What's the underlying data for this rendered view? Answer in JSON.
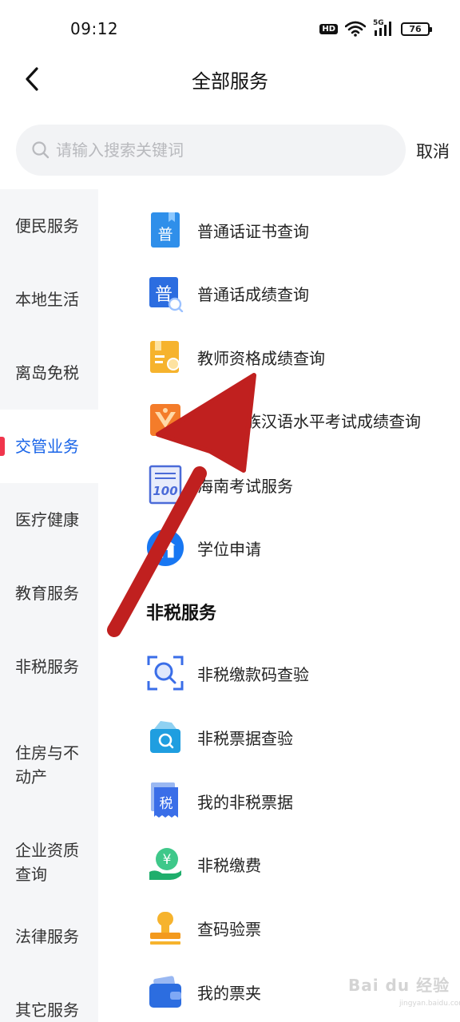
{
  "status_bar": {
    "time": "09:12",
    "hd": "HD",
    "signal_label": "5G",
    "battery": "76"
  },
  "header": {
    "title": "全部服务"
  },
  "search": {
    "placeholder": "请输入搜索关键词",
    "value": "",
    "cancel_label": "取消"
  },
  "sidebar": {
    "items": [
      {
        "label": "便民服务"
      },
      {
        "label": "本地生活"
      },
      {
        "label": "离岛免税"
      },
      {
        "label": "交管业务",
        "active": true
      },
      {
        "label": "医疗健康"
      },
      {
        "label": "教育服务"
      },
      {
        "label": "非税服务"
      },
      {
        "label": "住房与不动产"
      },
      {
        "label": "企业资质查询"
      },
      {
        "label": "法律服务"
      },
      {
        "label": "其它服务"
      }
    ]
  },
  "education_services": [
    {
      "label": "普通话证书查询",
      "icon": "putonghua-certificate-icon",
      "glyph": "普"
    },
    {
      "label": "普通话成绩查询",
      "icon": "putonghua-score-icon",
      "glyph": "普"
    },
    {
      "label": "教师资格成绩查询",
      "icon": "teacher-qualification-icon"
    },
    {
      "label": "少数民族汉语水平考试成绩查询",
      "icon": "minority-language-exam-icon"
    },
    {
      "label": "海南考试服务",
      "icon": "hainan-exam-icon",
      "glyph": "100"
    },
    {
      "label": "学位申请",
      "icon": "degree-application-icon"
    }
  ],
  "nontax_section": {
    "title": "非税服务",
    "items": [
      {
        "label": "非税缴款码查验",
        "icon": "scan-verify-icon"
      },
      {
        "label": "非税票据查验",
        "icon": "receipt-verify-icon"
      },
      {
        "label": "我的非税票据",
        "icon": "my-receipt-icon",
        "glyph": "税"
      },
      {
        "label": "非税缴费",
        "icon": "payment-icon",
        "glyph": "¥"
      },
      {
        "label": "查码验票",
        "icon": "stamp-icon"
      },
      {
        "label": "我的票夹",
        "icon": "wallet-icon"
      }
    ]
  },
  "colors": {
    "accent": "#1763e8",
    "indicator": "#f0354c",
    "arrow": "#c0201f"
  },
  "watermark": {
    "text": "Bai du 经验",
    "sub": "jingyan.baidu.com"
  }
}
